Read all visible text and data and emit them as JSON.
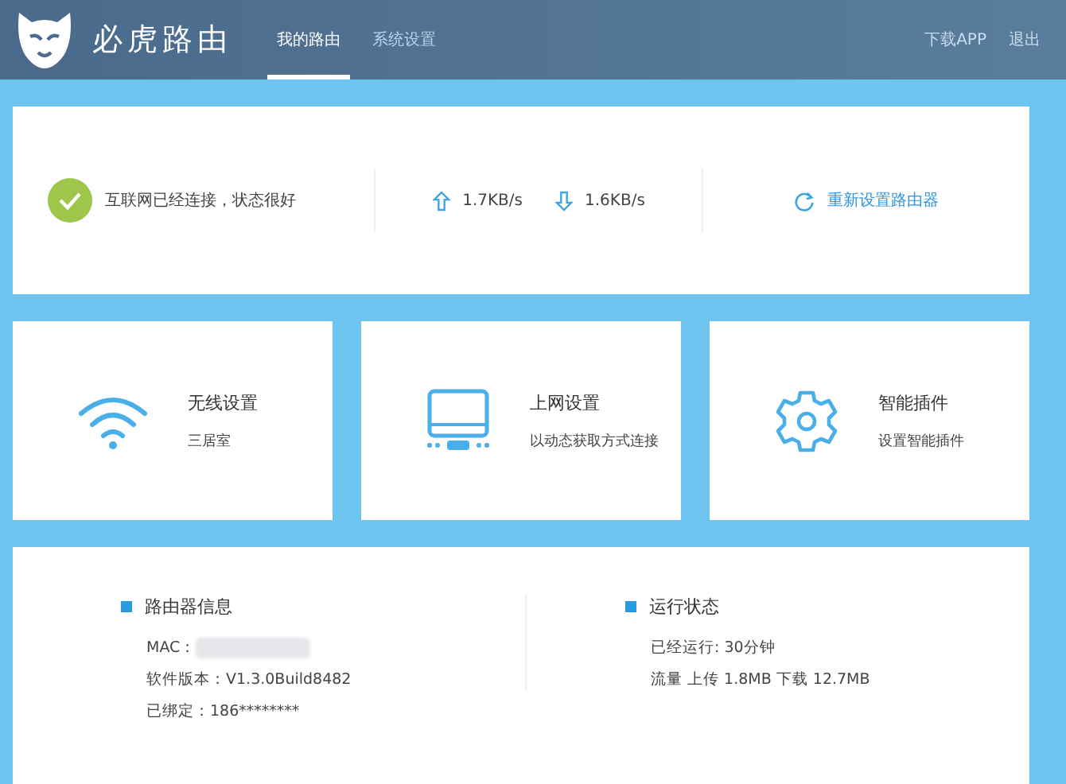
{
  "header": {
    "brand": "必虎路由",
    "tabs": [
      {
        "label": "我的路由",
        "selected": true
      },
      {
        "label": "系统设置",
        "selected": false
      }
    ],
    "links": [
      "下载APP",
      "退出"
    ]
  },
  "status": {
    "connected": true,
    "message": "互联网已经连接，状态很好",
    "upload": "1.7KB/s",
    "download": "1.6KB/s",
    "reset_link": "重新设置路由器"
  },
  "cards": [
    {
      "kind": "wifi",
      "title": "无线设置",
      "subtitle": "三居室"
    },
    {
      "kind": "monitor",
      "title": "上网设置",
      "subtitle": "以动态获取方式连接"
    },
    {
      "kind": "gear",
      "title": "智能插件",
      "subtitle": "设置智能插件"
    }
  ],
  "info": [
    {
      "title": "路由器信息",
      "lines": [
        {
          "kind": "redacted",
          "label": "MAC："
        },
        {
          "kind": "text",
          "text": "软件版本：V1.3.0Build8482"
        },
        {
          "kind": "text",
          "text": "已绑定：186********"
        }
      ]
    },
    {
      "title": "运行状态",
      "lines": [
        {
          "kind": "text",
          "text": "已经运行: 30分钟"
        },
        {
          "kind": "text",
          "text": "流量 上传 1.8MB 下载 12.7MB"
        }
      ]
    }
  ]
}
